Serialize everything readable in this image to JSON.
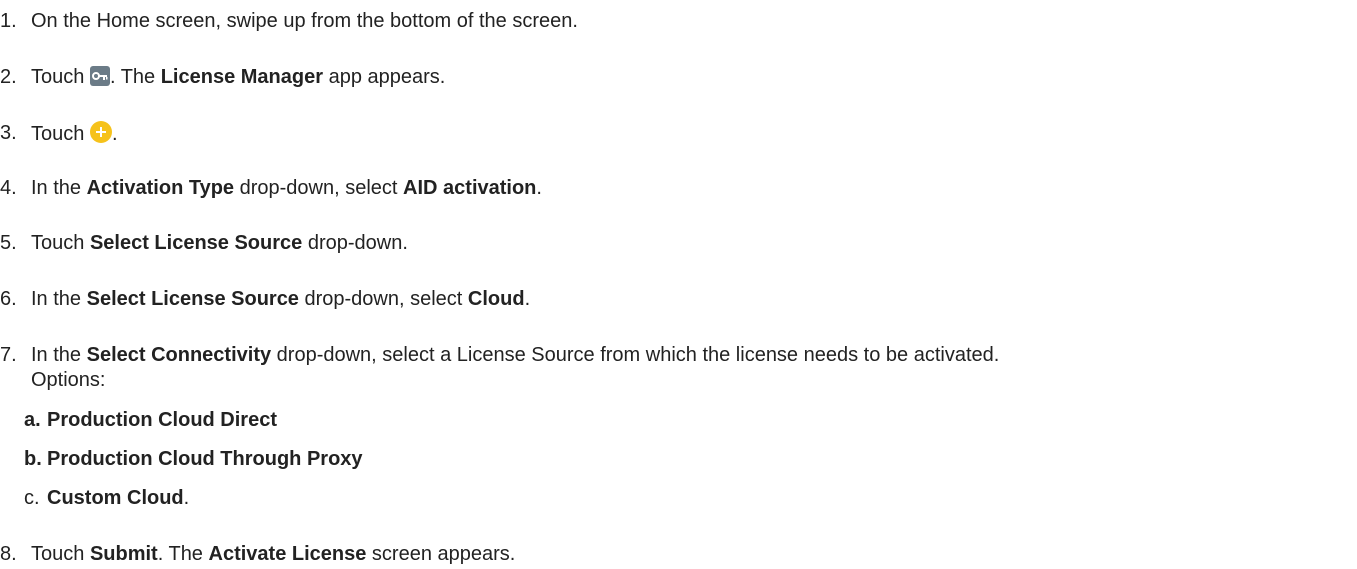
{
  "steps": [
    {
      "num": "1.",
      "parts": [
        "On the Home screen, swipe up from the bottom of the screen."
      ]
    },
    {
      "num": "2.",
      "parts": [
        "Touch ",
        ". The ",
        "License Manager",
        " app appears."
      ],
      "icon": "key-icon"
    },
    {
      "num": "3.",
      "parts": [
        "Touch ",
        "."
      ],
      "icon": "plus-circle-icon"
    },
    {
      "num": "4.",
      "parts": [
        "In the ",
        "Activation Type",
        " drop-down, select ",
        "AID activation",
        "."
      ]
    },
    {
      "num": "5.",
      "parts": [
        "Touch ",
        "Select License Source",
        " drop-down."
      ]
    },
    {
      "num": "6.",
      "parts": [
        "In the ",
        "Select License Source",
        " drop-down, select ",
        "Cloud",
        "."
      ]
    },
    {
      "num": "7.",
      "parts": [
        "In the ",
        "Select Connectivity",
        " drop-down, select a License Source from which the license needs to be activated.",
        "Options:"
      ]
    },
    {
      "num": "8.",
      "parts": [
        "Touch ",
        "Submit",
        ". The ",
        "Activate License",
        " screen appears."
      ]
    }
  ],
  "options": [
    {
      "letter": "a.",
      "label": "Production Cloud Direct",
      "suffix": ""
    },
    {
      "letter": "b.",
      "label": "Production Cloud Through Proxy",
      "suffix": ""
    },
    {
      "letter": "c.",
      "label": "Custom Cloud",
      "suffix": "."
    }
  ],
  "colors": {
    "key_icon_bg": "#6b7b87",
    "plus_icon_bg": "#f6c21b",
    "text": "#222222"
  }
}
